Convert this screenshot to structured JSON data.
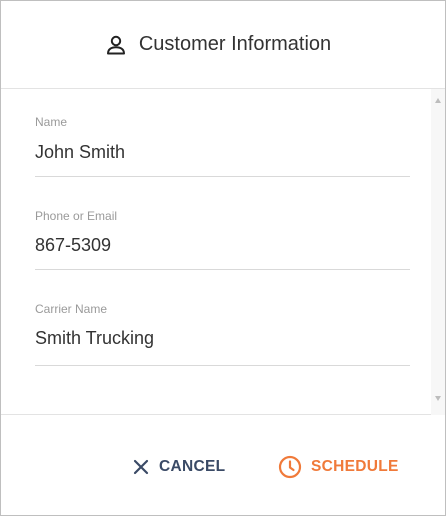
{
  "dialog": {
    "title": "Customer Information",
    "title_icon": "user-icon"
  },
  "fields": [
    {
      "label": "Name",
      "value": "John Smith"
    },
    {
      "label": "Phone or Email",
      "value": "867-5309"
    },
    {
      "label": "Carrier Name",
      "value": "Smith Trucking"
    }
  ],
  "footer": {
    "cancel_label": "CANCEL",
    "cancel_icon": "close-icon",
    "schedule_label": "SCHEDULE",
    "schedule_icon": "clock-icon"
  },
  "colors": {
    "cancel": "#3a4a66",
    "schedule": "#f07a3a",
    "label": "#9a9a9a",
    "text": "#333333"
  }
}
